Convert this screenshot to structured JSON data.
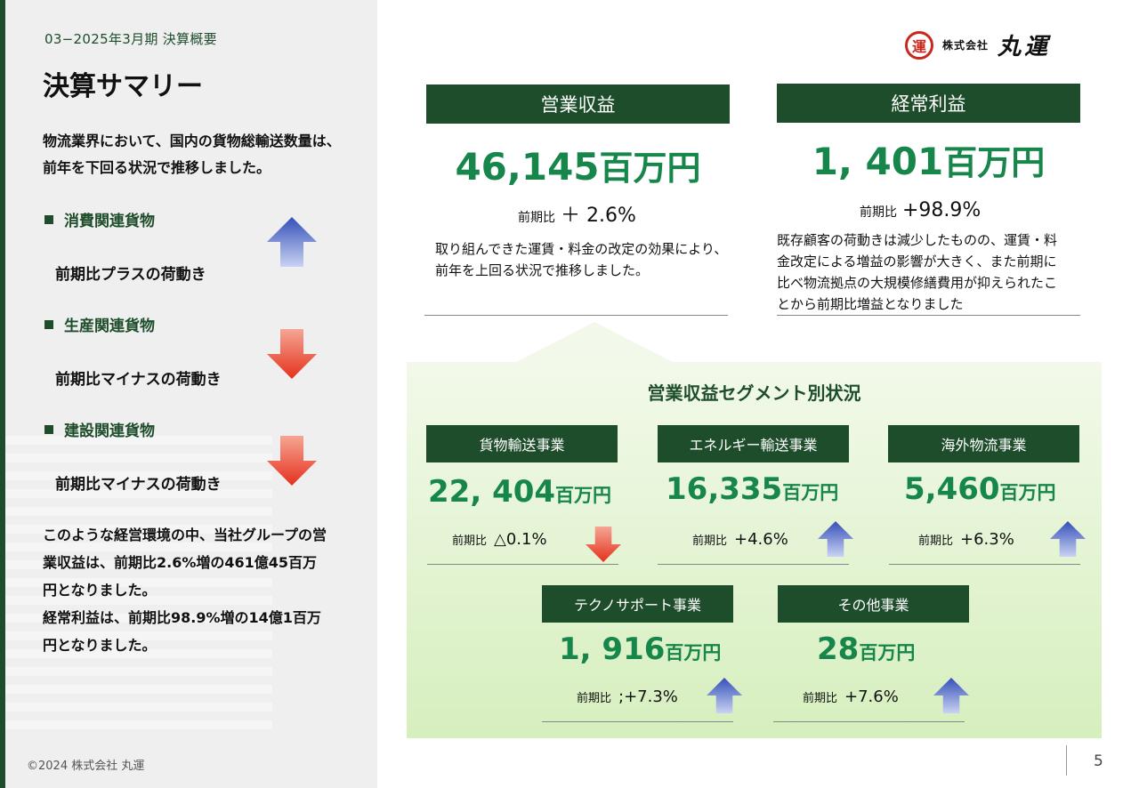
{
  "header": {
    "subtitle": "03−2025年3月期 決算概要",
    "title": "決算サマリー"
  },
  "intro": {
    "line1": "物流業界において、国内の貨物総輸送数量は、",
    "line2": "前年を下回る状況で推移しました。"
  },
  "cargo": [
    {
      "label": "消費関連貨物",
      "desc": "前期比プラスの荷動き",
      "direction": "up"
    },
    {
      "label": "生産関連貨物",
      "desc": "前期比マイナスの荷動き",
      "direction": "down"
    },
    {
      "label": "建設関連貨物",
      "desc": "前期比マイナスの荷動き",
      "direction": "down"
    }
  ],
  "summary": {
    "line1": "このような経営環境の中、当社グループの営",
    "line2": "業収益は、前期比2.6%増の461億45百万",
    "line3": "円となりました。",
    "line4": "経常利益は、前期比98.9%増の14億1百万",
    "line5": "円となりました。"
  },
  "logo": {
    "seal": "運",
    "small": "株式会社",
    "big": "丸運"
  },
  "kpi": {
    "revenue": {
      "label": "営業収益",
      "value": "46,145",
      "unit": "百万円",
      "ratio_label": "前期比",
      "ratio": "＋ 2.6%",
      "desc1": "取り組んできた運賃・料金の改定の効果により、",
      "desc2": "前年を上回る状況で推移しました。"
    },
    "ordinary": {
      "label": "経常利益",
      "value": "1, 401",
      "unit": "百万円",
      "ratio_label": "前期比",
      "ratio": "+98.9%",
      "desc1": "既存顧客の荷動きは減少したものの、運賃・料",
      "desc2": "金改定による増益の影響が大きく、また前期に",
      "desc3": "比べ物流拠点の大規模修繕費用が抑えられたこ",
      "desc4": "とから前期比増益となりました"
    }
  },
  "segments_title": "営業収益セグメント別状況",
  "segments": [
    {
      "label": "貨物輸送事業",
      "value": "22, 404",
      "unit": "百万円",
      "ratio_label": "前期比",
      "ratio": "△0.1%",
      "direction": "down"
    },
    {
      "label": "エネルギー輸送事業",
      "value": "16,335",
      "unit": "百万円",
      "ratio_label": "前期比",
      "ratio": "+4.6%",
      "direction": "up"
    },
    {
      "label": "海外物流事業",
      "value": "5,460",
      "unit": "百万円",
      "ratio_label": "前期比",
      "ratio": "+6.3%",
      "direction": "up"
    },
    {
      "label": "テクノサポート事業",
      "value": "1, 916",
      "unit": "百万円",
      "ratio_label": "前期比",
      "ratio": ";+7.3%",
      "direction": "up"
    },
    {
      "label": "その他事業",
      "value": "28",
      "unit": "百万円",
      "ratio_label": "前期比",
      "ratio": "+7.6%",
      "direction": "up"
    }
  ],
  "footer": {
    "copyright": "©2024 株式会社 丸運",
    "page": "5"
  },
  "colors": {
    "brand_green": "#1e4d2b",
    "value_green": "#16864a",
    "arrow_up": "#4a66c4",
    "arrow_down": "#e8402a",
    "logo_red": "#c8281e"
  }
}
